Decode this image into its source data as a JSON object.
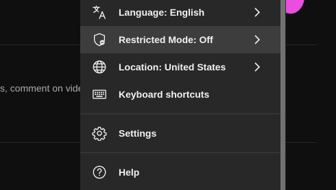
{
  "background": {
    "partial_text": "s, comment on vide"
  },
  "menu": {
    "items": [
      {
        "label": "Language: English",
        "icon": "translate-icon",
        "has_submenu": true
      },
      {
        "label": "Restricted Mode: Off",
        "icon": "restricted-mode-shield-icon",
        "has_submenu": true
      },
      {
        "label": "Location: United States",
        "icon": "globe-icon",
        "has_submenu": true
      },
      {
        "label": "Keyboard shortcuts",
        "icon": "keyboard-icon",
        "has_submenu": false
      },
      {
        "label": "Settings",
        "icon": "gear-icon",
        "has_submenu": false
      },
      {
        "label": "Help",
        "icon": "help-icon",
        "has_submenu": false
      }
    ]
  },
  "colors": {
    "page_background": "#0f0f0f",
    "menu_background": "#282828",
    "hover_background": "#3d3d3d",
    "text": "#f1f1f1",
    "accent_blob": "#e94ee0"
  }
}
